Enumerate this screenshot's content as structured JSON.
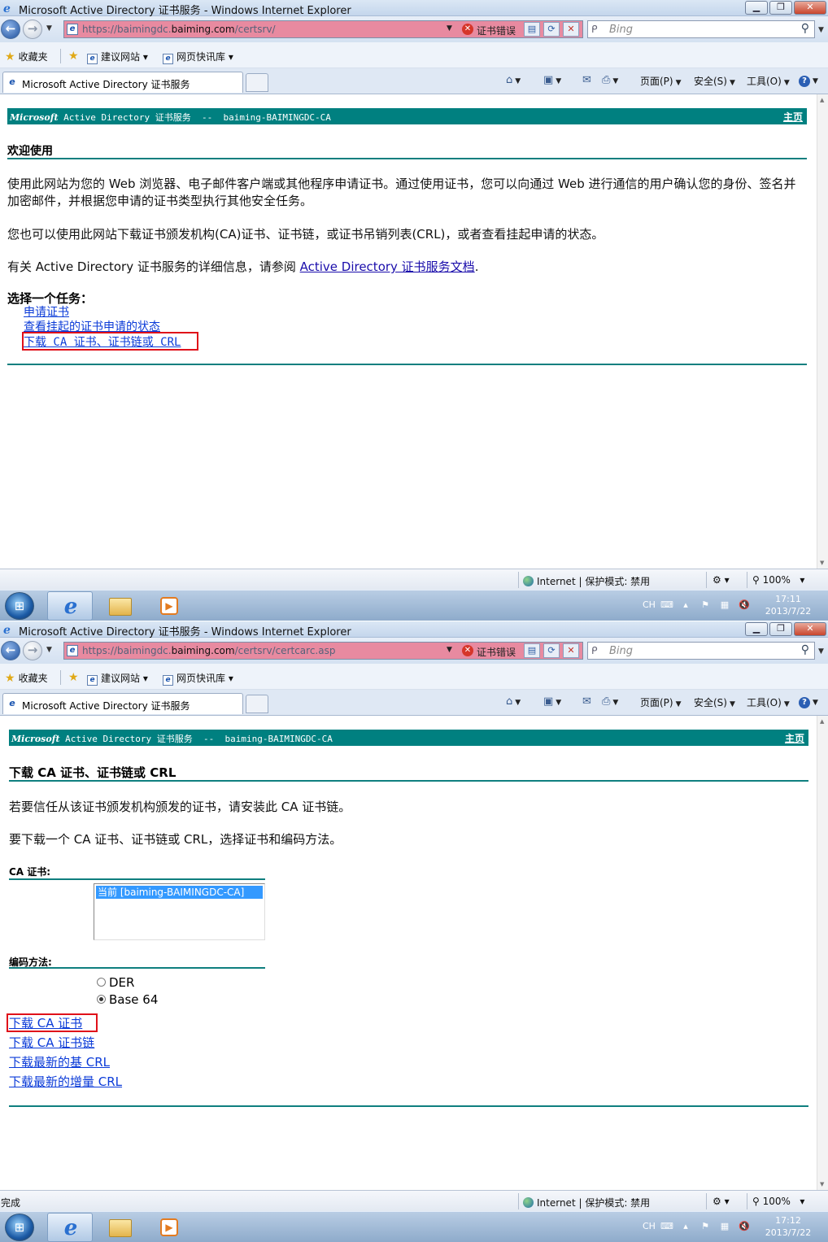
{
  "colors": {
    "header_teal": "#008080",
    "highlight_red": "#e0101a",
    "link_blue": "#0b3bd8"
  },
  "window1": {
    "title": "Microsoft Active Directory 证书服务 - Windows Internet Explorer",
    "address": {
      "url_prefix": "https://baimingdc.",
      "url_domain": "baiming.com",
      "url_suffix": "/certsrv/",
      "cert_error": "证书错误"
    },
    "search": {
      "engine": "Bing"
    },
    "favorites": {
      "label": "收藏夹",
      "suggested": "建议网站",
      "gallery": "网页快讯库"
    },
    "tab_title": "Microsoft Active Directory 证书服务",
    "commands": {
      "page": "页面(P)",
      "safety": "安全(S)",
      "tools": "工具(O)"
    },
    "page": {
      "header": "Active Directory 证书服务  --  baiming-BAIMINGDC-CA",
      "header_logo": "Microsoft",
      "home": "主页",
      "title": "欢迎使用",
      "para1": "使用此网站为您的 Web 浏览器、电子邮件客户端或其他程序申请证书。通过使用证书，您可以向通过 Web 进行通信的用户确认您的身份、签名并加密邮件，并根据您申请的证书类型执行其他安全任务。",
      "para2": "您也可以使用此网站下载证书颁发机构(CA)证书、证书链，或证书吊销列表(CRL)，或者查看挂起申请的状态。",
      "para3_prefix": "有关 Active Directory 证书服务的详细信息，请参阅 ",
      "para3_link": "Active Directory 证书服务文档",
      "para3_suffix": ".",
      "task_label": "选择一个任务：",
      "tasks": [
        "申请证书",
        "查看挂起的证书申请的状态",
        "下载 CA 证书、证书链或 CRL"
      ]
    },
    "status": {
      "zone": "Internet | 保护模式: 禁用",
      "zoom": "100%"
    },
    "clock": {
      "time": "17:11",
      "date": "2013/7/22"
    }
  },
  "window2": {
    "title": "Microsoft Active Directory 证书服务 - Windows Internet Explorer",
    "address": {
      "url_prefix": "https://baimingdc.",
      "url_domain": "baiming.com",
      "url_suffix": "/certsrv/certcarc.asp",
      "cert_error": "证书错误"
    },
    "search": {
      "engine": "Bing"
    },
    "favorites": {
      "label": "收藏夹",
      "suggested": "建议网站",
      "gallery": "网页快讯库"
    },
    "tab_title": "Microsoft Active Directory 证书服务",
    "commands": {
      "page": "页面(P)",
      "safety": "安全(S)",
      "tools": "工具(O)"
    },
    "page": {
      "header": "Active Directory 证书服务  --  baiming-BAIMINGDC-CA",
      "header_logo": "Microsoft",
      "home": "主页",
      "title": "下载 CA 证书、证书链或 CRL",
      "para1": "若要信任从该证书颁发机构颁发的证书，请安装此 CA 证书链。",
      "para2": "要下载一个 CA 证书、证书链或 CRL，选择证书和编码方法。",
      "ca_label": "CA 证书:",
      "ca_selected": "当前 [baiming-BAIMINGDC-CA]",
      "encoding_label": "编码方法:",
      "encoding_options": [
        "DER",
        "Base 64"
      ],
      "encoding_selected": "Base 64",
      "links": [
        "下载 CA 证书",
        "下载 CA 证书链",
        "下载最新的基 CRL",
        "下载最新的增量 CRL"
      ]
    },
    "status": {
      "left": "完成",
      "zone": "Internet | 保护模式: 禁用",
      "zoom": "100%"
    },
    "clock": {
      "time": "17:12",
      "date": "2013/7/22"
    }
  },
  "taskbar": {
    "lang": "CH"
  }
}
